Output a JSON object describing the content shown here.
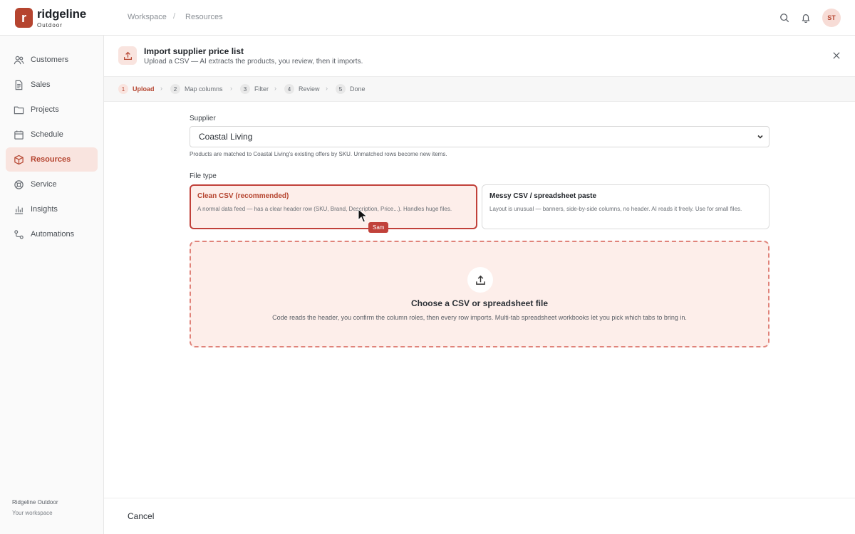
{
  "brand": {
    "logo_letter": "r",
    "name": "ridgeline",
    "sub": "Outdoor",
    "accent": "#b5442f"
  },
  "breadcrumb": [
    "Workspace",
    "Resources"
  ],
  "topbar": {
    "avatar_initials": "ST"
  },
  "sidebar": {
    "items": [
      {
        "label": "Customers",
        "icon": "users-icon"
      },
      {
        "label": "Sales",
        "icon": "document-icon"
      },
      {
        "label": "Projects",
        "icon": "folder-icon"
      },
      {
        "label": "Schedule",
        "icon": "calendar-icon"
      },
      {
        "label": "Resources",
        "icon": "box-icon",
        "active": true
      },
      {
        "label": "Service",
        "icon": "lifebuoy-icon"
      },
      {
        "label": "Insights",
        "icon": "bar-chart-icon"
      },
      {
        "label": "Automations",
        "icon": "flow-icon"
      }
    ],
    "workspace_name": "Ridgeline Outdoor",
    "workspace_sub": "Your workspace"
  },
  "import": {
    "title": "Import supplier price list",
    "subtitle": "Upload a CSV — AI extracts the products, you review, then it imports."
  },
  "steps": [
    {
      "num": "1",
      "label": "Upload",
      "active": true
    },
    {
      "num": "2",
      "label": "Map columns"
    },
    {
      "num": "3",
      "label": "Filter"
    },
    {
      "num": "4",
      "label": "Review"
    },
    {
      "num": "5",
      "label": "Done"
    }
  ],
  "form": {
    "supplier_label": "Supplier",
    "supplier_value": "Coastal Living",
    "supplier_hint": "Products are matched to Coastal Living's existing offers by SKU. Unmatched rows become new items.",
    "file_type_label": "File type",
    "options": [
      {
        "title": "Clean CSV (recommended)",
        "desc": "A normal data feed — has a clear header row (SKU, Brand, Description, Price...). Handles huge files.",
        "selected": true
      },
      {
        "title": "Messy CSV / spreadsheet paste",
        "desc": "Layout is unusual — banners, side-by-side columns, no header. AI reads it freely. Use for small files.",
        "selected": false
      }
    ]
  },
  "cursor": {
    "label": "Sam"
  },
  "dropzone": {
    "title": "Choose a CSV or spreadsheet file",
    "subtitle": "Code reads the header, you confirm the column roles, then every row imports. Multi-tab spreadsheet workbooks let you pick which tabs to bring in."
  },
  "footer": {
    "cancel_label": "Cancel"
  }
}
